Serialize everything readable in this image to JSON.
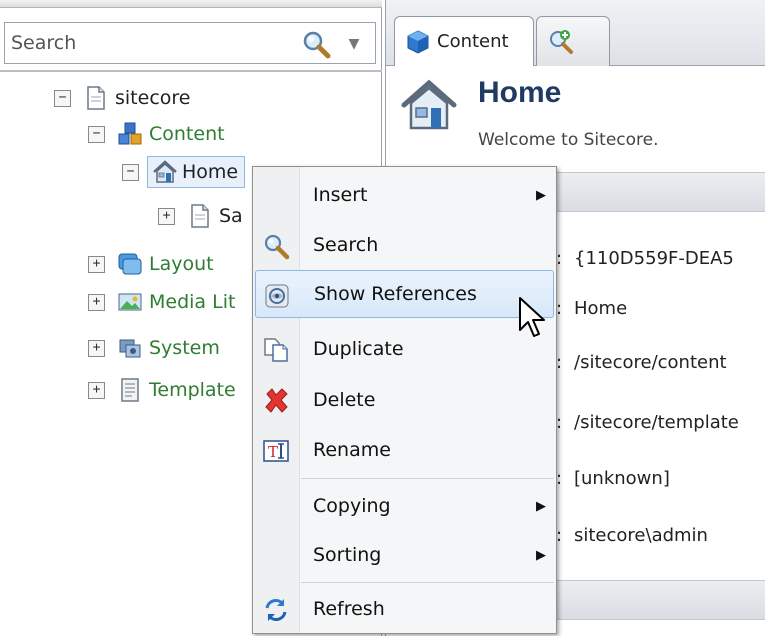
{
  "search": {
    "placeholder": "Search"
  },
  "tree": {
    "root": "sitecore",
    "content": "Content",
    "home": "Home",
    "sample_partial": "Sa",
    "layout": "Layout",
    "media_partial": "Media Lit",
    "system": "System",
    "templates_partial": "Template"
  },
  "tabs": [
    {
      "label": "Content"
    }
  ],
  "header": {
    "title": "Home",
    "subtitle": "Welcome to Sitecore."
  },
  "fields": [
    {
      "value": "{110D559F-DEA5"
    },
    {
      "value": "Home"
    },
    {
      "value": "/sitecore/content"
    },
    {
      "value": "/sitecore/template"
    },
    {
      "value": "[unknown]"
    },
    {
      "value": "sitecore\\admin"
    }
  ],
  "menu": {
    "items": [
      {
        "label": "Insert",
        "icon": "none",
        "submenu": true
      },
      {
        "label": "Search",
        "icon": "search-icon"
      },
      {
        "label": "Show References",
        "icon": "references-icon",
        "hover": true
      },
      {
        "label": "Duplicate",
        "icon": "duplicate-icon"
      },
      {
        "label": "Delete",
        "icon": "delete-icon"
      },
      {
        "label": "Rename",
        "icon": "rename-icon"
      },
      {
        "label": "Copying",
        "icon": "none",
        "submenu": true
      },
      {
        "label": "Sorting",
        "icon": "none",
        "submenu": true
      },
      {
        "label": "Refresh",
        "icon": "refresh-icon"
      }
    ]
  },
  "colors": {
    "tree_green": "#2e7d32",
    "hover_border": "#8cb7e6",
    "title": "#1f3b63"
  }
}
